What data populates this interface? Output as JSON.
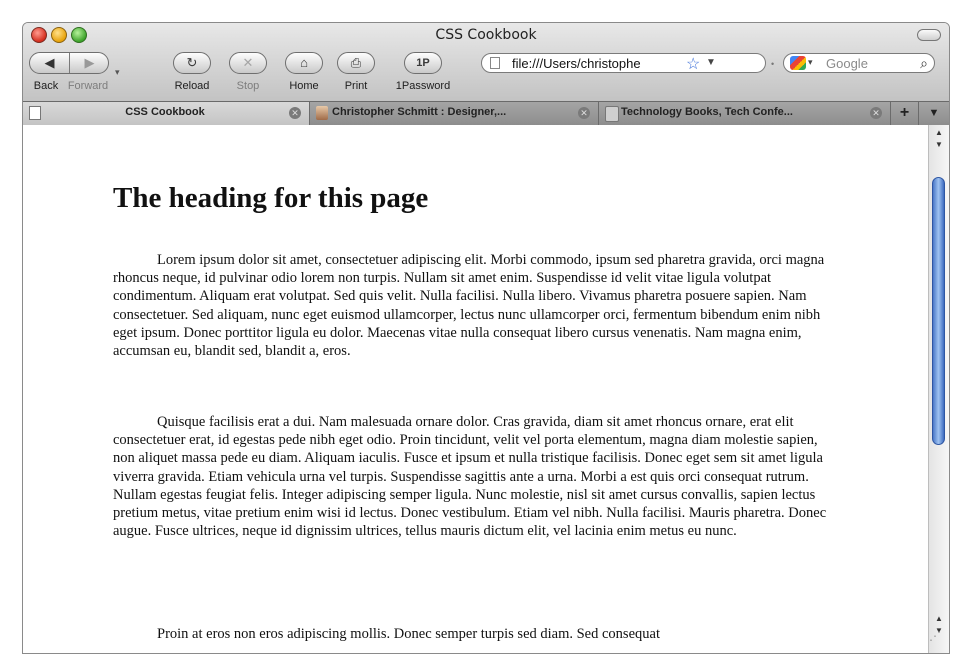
{
  "window": {
    "title": "CSS Cookbook"
  },
  "toolbar": {
    "back_label": "Back",
    "forward_label": "Forward",
    "reload_label": "Reload",
    "stop_label": "Stop",
    "home_label": "Home",
    "print_label": "Print",
    "onepassword_label": "1Password",
    "onepassword_glyph": "1P",
    "address_value": "file:///Users/christophe",
    "search_placeholder": "Google"
  },
  "tabs": [
    {
      "title": "CSS Cookbook",
      "active": true,
      "favicon": "document-icon"
    },
    {
      "title": "Christopher Schmitt : Designer,...",
      "active": false,
      "favicon": "photo-favicon"
    },
    {
      "title": "Technology Books, Tech Confe...",
      "active": false,
      "favicon": "oreilly-favicon"
    }
  ],
  "page": {
    "heading": "The heading for this page",
    "paragraphs": [
      "Lorem ipsum dolor sit amet, consectetuer adipiscing elit. Morbi commodo, ipsum sed pharetra gravida, orci magna rhoncus neque, id pulvinar odio lorem non turpis. Nullam sit amet enim. Suspendisse id velit vitae ligula volutpat condimentum. Aliquam erat volutpat. Sed quis velit. Nulla facilisi. Nulla libero. Vivamus pharetra posuere sapien. Nam consectetuer. Sed aliquam, nunc eget euismod ullamcorper, lectus nunc ullamcorper orci, fermentum bibendum enim nibh eget ipsum. Donec porttitor ligula eu dolor. Maecenas vitae nulla consequat libero cursus venenatis. Nam magna enim, accumsan eu, blandit sed, blandit a, eros.",
      "Quisque facilisis erat a dui. Nam malesuada ornare dolor. Cras gravida, diam sit amet rhoncus ornare, erat elit consectetuer erat, id egestas pede nibh eget odio. Proin tincidunt, velit vel porta elementum, magna diam molestie sapien, non aliquet massa pede eu diam. Aliquam iaculis. Fusce et ipsum et nulla tristique facilisis. Donec eget sem sit amet ligula viverra gravida. Etiam vehicula urna vel turpis. Suspendisse sagittis ante a urna. Morbi a est quis orci consequat rutrum. Nullam egestas feugiat felis. Integer adipiscing semper ligula. Nunc molestie, nisl sit amet cursus convallis, sapien lectus pretium metus, vitae pretium enim wisi id lectus. Donec vestibulum. Etiam vel nibh. Nulla facilisi. Mauris pharetra. Donec augue. Fusce ultrices, neque id dignissim ultrices, tellus mauris dictum elit, vel lacinia enim metus eu nunc.",
      "Proin at eros non eros adipiscing mollis. Donec semper turpis sed diam. Sed consequat"
    ]
  },
  "colors": {
    "close": "#d42e1e",
    "minimize": "#e7a20a",
    "zoom": "#3ea32b",
    "scroll_thumb": "#4a77c8"
  }
}
